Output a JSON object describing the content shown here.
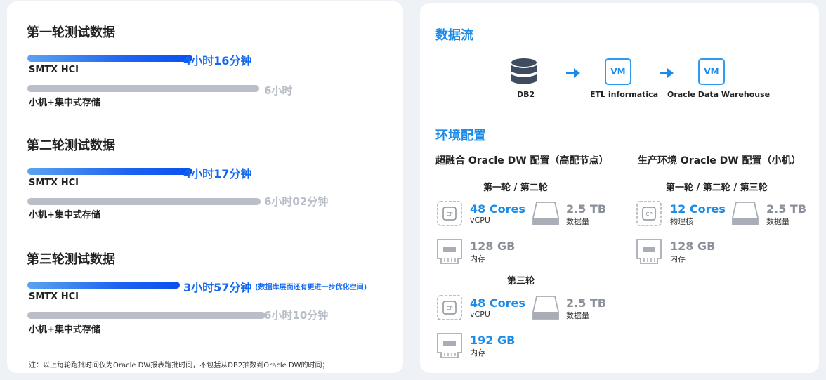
{
  "left": {
    "rounds": [
      {
        "title": "第一轮测试数据",
        "hci_time": "4小时16分钟",
        "hci_label": "SMTX HCI",
        "hci_hours": 4.27,
        "legacy_time": "6小时",
        "legacy_label": "小机+集中式存储",
        "legacy_hours": 6.0
      },
      {
        "title": "第二轮测试数据",
        "hci_time": "4小时17分钟",
        "hci_label": "SMTX HCI",
        "hci_hours": 4.28,
        "legacy_time": "6小时02分钟",
        "legacy_label": "小机+集中式存储",
        "legacy_hours": 6.03
      },
      {
        "title": "第三轮测试数据",
        "hci_time": "3小时57分钟",
        "hci_note": "(数据库层面还有更进一步优化空间)",
        "hci_label": "SMTX HCI",
        "hci_hours": 3.95,
        "legacy_time": "6小时10分钟",
        "legacy_label": "小机+集中式存储",
        "legacy_hours": 6.17
      }
    ],
    "footnote": "注：以上每轮跑批时间仅为Oracle DW报表跑批时间，不包括从DB2抽数到Oracle DW的时间；"
  },
  "right": {
    "flow_title": "数据流",
    "flow": {
      "db2_label": "DB2",
      "etl_vm": "VM",
      "etl_label": "ETL informatica",
      "dw_vm": "VM",
      "dw_label": "Oracle Data Warehouse"
    },
    "env_title": "环境配置",
    "hci_config_title": "超融合 Oracle DW 配置（高配节点）",
    "prod_config_title": "生产环境 Oracle DW 配置（小机）",
    "hci_round12": {
      "title": "第一轮 / 第二轮",
      "cpu_value": "48 Cores",
      "cpu_unit": "vCPU",
      "disk_value": "2.5 TB",
      "disk_unit": "数据量",
      "mem_value": "128 GB",
      "mem_unit": "内存"
    },
    "prod_rounds": {
      "title": "第一轮 / 第二轮 / 第三轮",
      "cpu_value": "12 Cores",
      "cpu_unit": "物理核",
      "disk_value": "2.5 TB",
      "disk_unit": "数据量",
      "mem_value": "128 GB",
      "mem_unit": "内存"
    },
    "hci_round3": {
      "title": "第三轮",
      "cpu_value": "48 Cores",
      "cpu_unit": "vCPU",
      "disk_value": "2.5 TB",
      "disk_unit": "数据量",
      "mem_value": "192 GB",
      "mem_unit": "内存"
    },
    "icon_cpu_text": "CP"
  },
  "colors": {
    "accent_blue": "#1a8be8",
    "bar_blue": "#1268f3",
    "bar_gray": "#b9bec8"
  }
}
